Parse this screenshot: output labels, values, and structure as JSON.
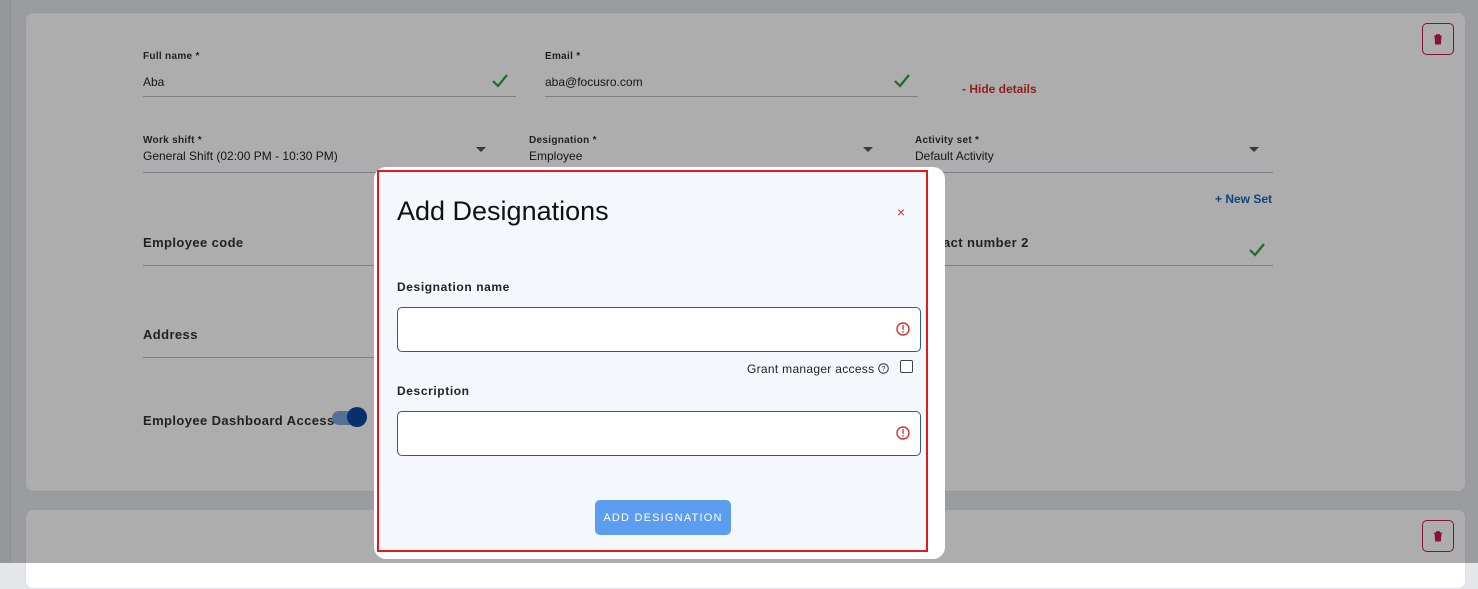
{
  "form": {
    "full_name": {
      "label": "Full name *",
      "value": "Aba"
    },
    "email": {
      "label": "Email *",
      "value": "aba@focusro.com"
    },
    "hide_details": "- Hide details",
    "work_shift": {
      "label": "Work shift *",
      "value": "General Shift (02:00 PM - 10:30 PM)"
    },
    "designation": {
      "label": "Designation *",
      "value": "Employee"
    },
    "activity_set": {
      "label": "Activity set *",
      "value": "Default Activity"
    },
    "new_set": "+ New Set",
    "employee_code": {
      "label": "Employee code"
    },
    "contact_number_2": {
      "label": "act number 2"
    },
    "address": {
      "label": "Address"
    },
    "dashboard_access": {
      "label": "Employee Dashboard Access",
      "enabled": true
    }
  },
  "modal": {
    "title": "Add Designations",
    "close": "×",
    "designation_name_label": "Designation name",
    "designation_name_value": "",
    "grant_manager_access": "Grant manager access",
    "grant_checked": false,
    "description_label": "Description",
    "description_value": "",
    "submit": "ADD DESIGNATION"
  },
  "colors": {
    "accent_red": "#d32f2f",
    "accent_blue": "#1565c0",
    "check_green": "#2e9e3e",
    "button": "#5b9def",
    "highlight_border": "#e01b1b"
  },
  "icons": [
    "trash-icon",
    "check-icon",
    "chevron-down-icon",
    "close-icon",
    "error-icon",
    "help-icon"
  ]
}
